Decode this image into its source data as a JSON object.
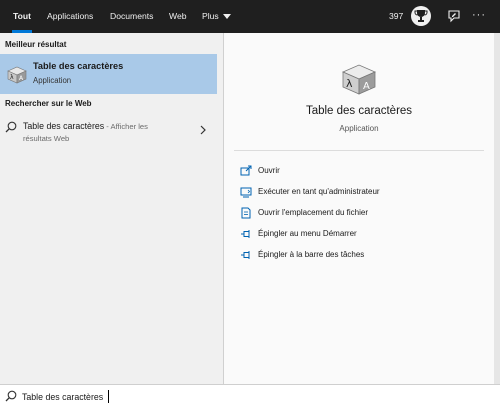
{
  "colors": {
    "topbar_bg": "#1f1f1f",
    "accent": "#0078d7",
    "selected_bg": "#a9c9e8",
    "left_bg": "#f0f0f0",
    "right_bg": "#fafafa"
  },
  "tabs": [
    {
      "label": "Tout",
      "active": true
    },
    {
      "label": "Applications"
    },
    {
      "label": "Documents"
    },
    {
      "label": "Web"
    },
    {
      "label": "Plus"
    }
  ],
  "topbar": {
    "points": "397",
    "rewards_icon": "trophy-icon",
    "feedback_icon": "feedback-icon",
    "more": "···"
  },
  "left": {
    "best_match_header": "Meilleur résultat",
    "best_match": {
      "title": "Table des caractères",
      "subtitle": "Application",
      "icon": "character-map-icon"
    },
    "web_header": "Rechercher sur le Web",
    "web_item": {
      "title": "Table des caractères",
      "suffix": " - Afficher les",
      "subtitle": "résultats Web",
      "icon": "search-icon"
    }
  },
  "right": {
    "title": "Table des caractères",
    "subtitle": "Application",
    "actions": [
      {
        "label": "Ouvrir",
        "icon": "open-icon"
      },
      {
        "label": "Exécuter en tant qu'administrateur",
        "icon": "run-as-admin-icon"
      },
      {
        "label": "Ouvrir l'emplacement du fichier",
        "icon": "file-location-icon"
      },
      {
        "label": "Épingler au menu Démarrer",
        "icon": "pin-icon"
      },
      {
        "label": "Épingler à la barre des tâches",
        "icon": "pin-icon"
      }
    ]
  },
  "search": {
    "value": "Table des caractères",
    "icon": "search-icon"
  }
}
